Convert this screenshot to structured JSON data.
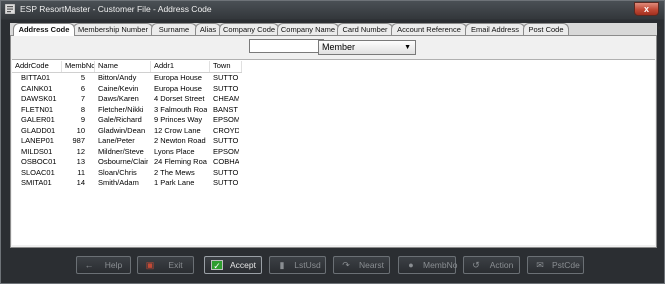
{
  "window": {
    "title": "ESP ResortMaster - Customer File - Address Code",
    "close_label": "x"
  },
  "tabs": [
    {
      "label": "Address Code",
      "active": true
    },
    {
      "label": "Membership Number",
      "active": false
    },
    {
      "label": "Surname",
      "active": false
    },
    {
      "label": "Alias",
      "active": false
    },
    {
      "label": "Company Code",
      "active": false
    },
    {
      "label": "Company Name",
      "active": false
    },
    {
      "label": "Card Number",
      "active": false
    },
    {
      "label": "Account Reference",
      "active": false
    },
    {
      "label": "Email Address",
      "active": false
    },
    {
      "label": "Post Code",
      "active": false
    }
  ],
  "search": {
    "value": ""
  },
  "filter": {
    "selected": "Member"
  },
  "table": {
    "columns": [
      "AddrCode",
      "MembNo",
      "Name",
      "Addr1",
      "Town"
    ],
    "rows": [
      [
        "BITTA01",
        "5",
        "Bitton/Andy",
        "Europa House",
        "SUTTO"
      ],
      [
        "CAINK01",
        "6",
        "Caine/Kevin",
        "Europa House",
        "SUTTO"
      ],
      [
        "DAWSK01",
        "7",
        "Daws/Karen",
        "4 Dorset Street",
        "CHEAM"
      ],
      [
        "FLETN01",
        "8",
        "Fletcher/Nikki",
        "3 Falmouth Road",
        "BANST"
      ],
      [
        "GALER01",
        "9",
        "Gale/Richard",
        "9 Princes Way",
        "EPSOM"
      ],
      [
        "GLADD01",
        "10",
        "Gladwin/Dean",
        "12 Crow Lane",
        "CROYD"
      ],
      [
        "LANEP01",
        "987",
        "Lane/Peter",
        "2 Newton Road",
        "SUTTO"
      ],
      [
        "MILDS01",
        "12",
        "Mildner/Steve",
        "Lyons Place",
        "EPSOM"
      ],
      [
        "OSBOC01",
        "13",
        "Osbourne/Claire",
        "24 Fleming Road",
        "COBHA"
      ],
      [
        "SLOAC01",
        "11",
        "Sloan/Chris",
        "2 The Mews",
        "SUTTO"
      ],
      [
        "SMITA01",
        "14",
        "Smith/Adam",
        "1 Park Lane",
        "SUTTO"
      ]
    ]
  },
  "buttons": [
    {
      "label": "Help",
      "icon": "help-icon",
      "enabled": false
    },
    {
      "label": "Exit",
      "icon": "exit-icon",
      "enabled": false
    },
    {
      "label": "Accept",
      "icon": "checkmark-icon",
      "enabled": true
    },
    {
      "label": "LstUsd",
      "icon": "last-used-icon",
      "enabled": false
    },
    {
      "label": "Nearst",
      "icon": "nearest-icon",
      "enabled": false
    },
    {
      "label": "MembNo",
      "icon": "radio-icon",
      "enabled": false
    },
    {
      "label": "Action",
      "icon": "action-icon",
      "enabled": false
    },
    {
      "label": "PstCde",
      "icon": "postcode-icon",
      "enabled": false
    }
  ],
  "colors": {
    "window_bg": "#2b2e32",
    "content_bg": "#f0f0f0",
    "accept_check": "#2f9e2f",
    "close_button": "#c24a36"
  }
}
